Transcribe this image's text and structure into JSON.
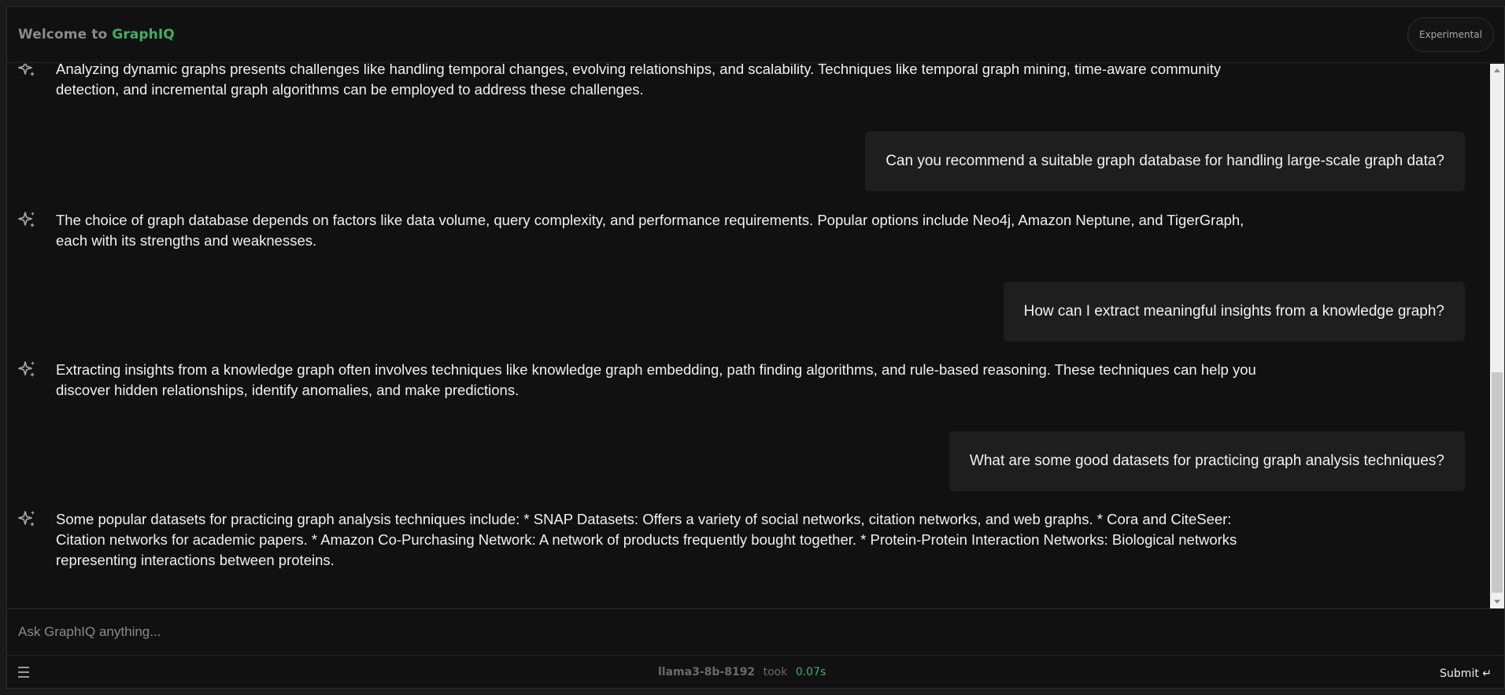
{
  "header": {
    "welcome_prefix": "Welcome to",
    "brand": "GraphIQ",
    "experimental_label": "Experimental"
  },
  "colors": {
    "accent": "#3fae6a",
    "background": "#111111",
    "user_bubble": "#1e1e1e"
  },
  "messages": [
    {
      "role": "assistant",
      "icon": "sparkle-icon",
      "text": "Analyzing dynamic graphs presents challenges like handling temporal changes, evolving relationships, and scalability. Techniques like temporal graph mining, time-aware community detection, and incremental graph algorithms can be employed to address these challenges."
    },
    {
      "role": "user",
      "text": "Can you recommend a suitable graph database for handling large-scale graph data?"
    },
    {
      "role": "assistant",
      "icon": "sparkle-icon",
      "text": "The choice of graph database depends on factors like data volume, query complexity, and performance requirements. Popular options include Neo4j, Amazon Neptune, and TigerGraph, each with its strengths and weaknesses."
    },
    {
      "role": "user",
      "text": "How can I extract meaningful insights from a knowledge graph?"
    },
    {
      "role": "assistant",
      "icon": "sparkle-icon",
      "text": "Extracting insights from a knowledge graph often involves techniques like knowledge graph embedding, path finding algorithms, and rule-based reasoning. These techniques can help you discover hidden relationships, identify anomalies, and make predictions."
    },
    {
      "role": "user",
      "text": "What are some good datasets for practicing graph analysis techniques?"
    },
    {
      "role": "assistant",
      "icon": "sparkle-icon",
      "text": "Some popular datasets for practicing graph analysis techniques include: * SNAP Datasets: Offers a variety of social networks, citation networks, and web graphs. * Cora and CiteSeer: Citation networks for academic papers. * Amazon Co-Purchasing Network: A network of products frequently bought together. * Protein-Protein Interaction Networks: Biological networks representing interactions between proteins."
    }
  ],
  "input": {
    "placeholder": "Ask GraphIQ anything...",
    "value": ""
  },
  "footer": {
    "menu_icon": "hamburger-menu-icon",
    "model": "llama3-8b-8192",
    "took_label": "took",
    "took_time": "0.07s",
    "submit_label": "Submit ↵"
  }
}
